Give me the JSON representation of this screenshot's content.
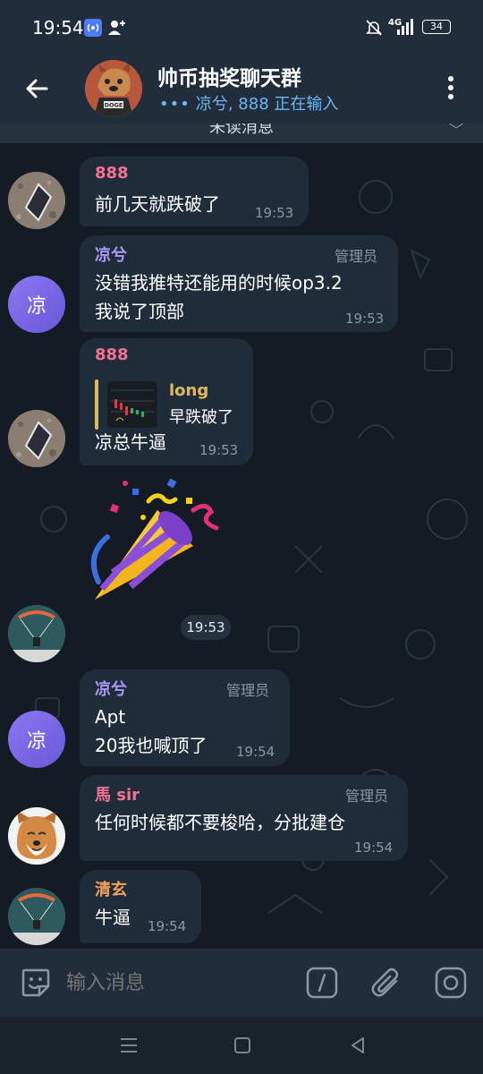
{
  "status_bar": {
    "time": "19:54",
    "network": "4G",
    "battery": "34",
    "icons": [
      "nfc-icon",
      "add-user-icon",
      "mute-icon",
      "signal-icon",
      "battery-icon"
    ]
  },
  "header": {
    "title": "帅币抽奖聊天群",
    "typing_dots": "•••",
    "typing": "凉兮, 888 正在输入",
    "avatar_text": "DOGE"
  },
  "unread_banner": {
    "label": "未读消息"
  },
  "messages": [
    {
      "sender": "888",
      "sender_color": "#f27291",
      "lines": [
        "前几天就跌破了"
      ],
      "time": "19:53"
    },
    {
      "sender": "凉兮",
      "sender_color": "#a79af5",
      "role": "管理员",
      "lines": [
        "没错我推特还能用的时候op3.2",
        "我说了顶部"
      ],
      "time": "19:53",
      "avatar_letter": "凉"
    },
    {
      "sender": "888",
      "sender_color": "#f27291",
      "reply": {
        "name": "long",
        "text": "早跌破了"
      },
      "lines": [
        "凉总牛逼"
      ],
      "time": "19:53"
    },
    {
      "sticker": "party-popper",
      "time": "19:53"
    },
    {
      "sender": "凉兮",
      "sender_color": "#a79af5",
      "role": "管理员",
      "lines": [
        "Apt",
        "20我也喊顶了"
      ],
      "time": "19:54",
      "avatar_letter": "凉"
    },
    {
      "sender": "馬 sir",
      "sender_color": "#f27291",
      "role": "管理员",
      "lines": [
        "任何时候都不要梭哈，分批建仓"
      ],
      "time": "19:54"
    },
    {
      "sender": "清玄",
      "sender_color": "#f2a15a",
      "lines": [
        "牛逼"
      ],
      "time": "19:54"
    }
  ],
  "input_bar": {
    "placeholder": "输入消息"
  },
  "colors": {
    "background": "#141b24",
    "bar": "#222d3b",
    "bubble": "#212c3a",
    "accent": "#6fb5f0"
  }
}
